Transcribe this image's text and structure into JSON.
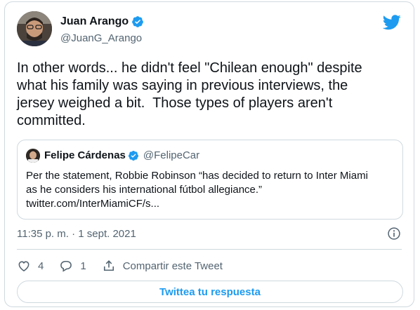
{
  "tweet": {
    "author_name": "Juan Arango",
    "author_handle": "@JuanG_Arango",
    "text": "In other words... he didn't feel \"Chilean enough\" despite\nwhat his family was saying in previous interviews, the\njersey weighed a bit.  Those types of players aren't\ncommitted.",
    "timestamp": "11:35 p. m. · 1 sept. 2021",
    "likes": "4",
    "replies": "1",
    "share_label": "Compartir este Tweet",
    "reply_button_label": "Twittea tu respuesta"
  },
  "quote": {
    "author_name": "Felipe Cárdenas",
    "author_handle": "@FelipeCar",
    "text": "Per the statement, Robbie Robinson “has decided to return to Inter Miami\nas he considers his international fútbol allegiance.”\ntwitter.com/InterMiamiCF/s..."
  },
  "colors": {
    "accent": "#1d9bf0",
    "verified": "#1d9bf0",
    "secondary_text": "#536471",
    "border": "#cfd9de"
  },
  "icons": [
    "verified-badge-icon",
    "twitter-bird-icon",
    "info-icon",
    "heart-icon",
    "reply-bubble-icon",
    "share-icon"
  ]
}
